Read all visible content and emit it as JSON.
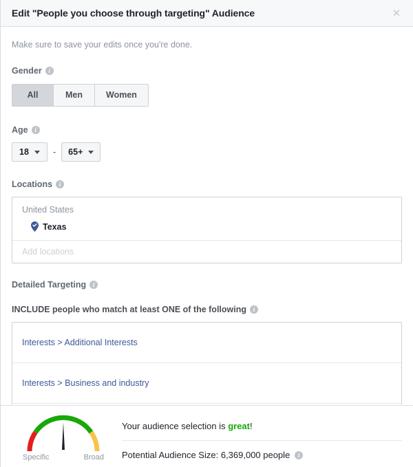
{
  "dialog": {
    "title": "Edit \"People you choose through targeting\" Audience",
    "close_icon": "close-icon",
    "intro": "Make sure to save your edits once you're done."
  },
  "gender": {
    "label": "Gender",
    "info_icon": "info-icon",
    "options": [
      {
        "label": "All",
        "selected": true
      },
      {
        "label": "Men",
        "selected": false
      },
      {
        "label": "Women",
        "selected": false
      }
    ]
  },
  "age": {
    "label": "Age",
    "info_icon": "info-icon",
    "min": "18",
    "max": "65+",
    "separator": "-"
  },
  "locations": {
    "label": "Locations",
    "info_icon": "info-icon",
    "country": "United States",
    "items": [
      {
        "name": "Texas",
        "icon": "map-pin-check-icon"
      }
    ],
    "add_placeholder": "Add locations",
    "add_value": ""
  },
  "detailed_targeting": {
    "label": "Detailed Targeting",
    "info_icon": "info-icon",
    "include_label": "INCLUDE people who match at least ONE of the following",
    "include_info_icon": "info-icon",
    "rows": [
      {
        "text": "Interests > Additional Interests"
      },
      {
        "text": "Interests > Business and industry"
      }
    ]
  },
  "footer": {
    "gauge": {
      "specific_label": "Specific",
      "broad_label": "Broad",
      "needle_angle_deg": 0,
      "colors": {
        "low": "#e41e1e",
        "good": "#17a80a",
        "high": "#f7c34c",
        "needle": "#1d2129"
      }
    },
    "quality_prefix": "Your audience selection is ",
    "quality_word": "great",
    "quality_suffix": "!",
    "size_text": "Potential Audience Size: 6,369,000 people",
    "size_info_icon": "info-icon"
  }
}
